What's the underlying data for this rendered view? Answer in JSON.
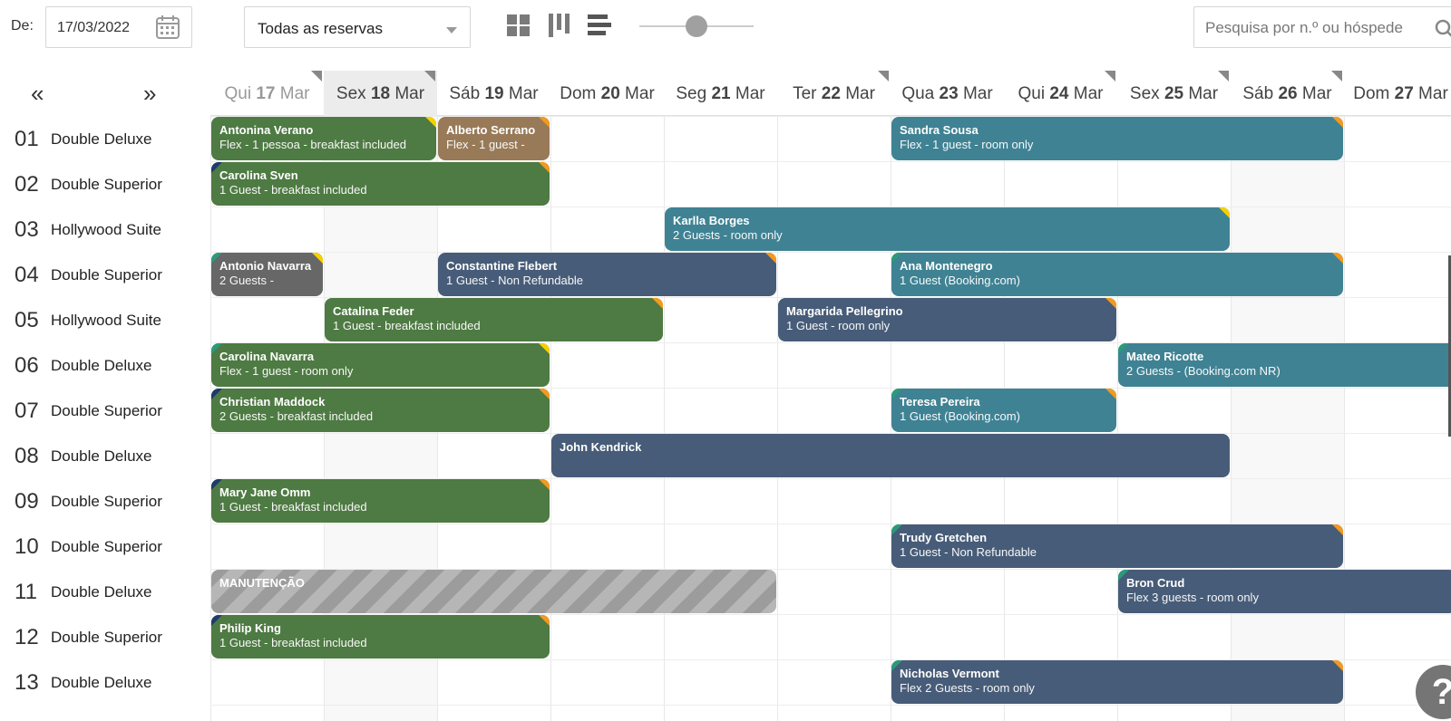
{
  "toolbar": {
    "from_label": "De:",
    "date_value": "17/03/2022",
    "filter_value": "Todas as reservas",
    "search_placeholder": "Pesquisa por n.º ou hóspede",
    "zoom_level": 0.5
  },
  "nav": {
    "prev": "«",
    "next": "»"
  },
  "days": [
    {
      "wd": "Qui",
      "d": "17",
      "m": "Mar"
    },
    {
      "wd": "Sex",
      "d": "18",
      "m": "Mar"
    },
    {
      "wd": "Sáb",
      "d": "19",
      "m": "Mar"
    },
    {
      "wd": "Dom",
      "d": "20",
      "m": "Mar"
    },
    {
      "wd": "Seg",
      "d": "21",
      "m": "Mar"
    },
    {
      "wd": "Ter",
      "d": "22",
      "m": "Mar"
    },
    {
      "wd": "Qua",
      "d": "23",
      "m": "Mar"
    },
    {
      "wd": "Qui",
      "d": "24",
      "m": "Mar"
    },
    {
      "wd": "Sex",
      "d": "25",
      "m": "Mar"
    },
    {
      "wd": "Sáb",
      "d": "26",
      "m": "Mar"
    },
    {
      "wd": "Dom",
      "d": "27",
      "m": "Mar"
    }
  ],
  "rooms": [
    {
      "num": "01",
      "name": "Double Deluxe"
    },
    {
      "num": "02",
      "name": "Double Superior"
    },
    {
      "num": "03",
      "name": "Hollywood Suite"
    },
    {
      "num": "04",
      "name": "Double Superior"
    },
    {
      "num": "05",
      "name": "Hollywood Suite"
    },
    {
      "num": "06",
      "name": "Double Deluxe"
    },
    {
      "num": "07",
      "name": "Double Superior"
    },
    {
      "num": "08",
      "name": "Double Deluxe"
    },
    {
      "num": "09",
      "name": "Double Superior"
    },
    {
      "num": "10",
      "name": "Double Superior"
    },
    {
      "num": "11",
      "name": "Double Deluxe"
    },
    {
      "num": "12",
      "name": "Double Superior"
    },
    {
      "num": "13",
      "name": "Double Deluxe"
    }
  ],
  "bookings": [
    {
      "name": "Antonina Verano",
      "info": "Flex - 1 pessoa - breakfast included",
      "room": "01",
      "from": "17/03",
      "to": "19/03",
      "color": "#4e7a43",
      "flag_right": "#f5d000"
    },
    {
      "name": "Alberto Serrano",
      "info": "Flex - 1 guest -",
      "room": "01",
      "from": "19/03",
      "to": "20/03",
      "color": "#987a58",
      "flag_right": "#f39a1e"
    },
    {
      "name": "Sandra Sousa",
      "info": "Flex - 1 guest - room only",
      "room": "01",
      "from": "23/03",
      "to": "27/03",
      "color": "#3f8293",
      "flag_right": "#f39a1e"
    },
    {
      "name": "Carolina Sven",
      "info": "1 Guest - breakfast included",
      "room": "02",
      "from": "17/03",
      "to": "20/03",
      "color": "#4e7a43",
      "flag_left": "#1e3a6e",
      "flag_right": "#f39a1e"
    },
    {
      "name": "Karlla Borges",
      "info": "2 Guests - room only",
      "room": "03",
      "from": "21/03",
      "to": "26/03",
      "color": "#3f8293",
      "flag_right": "#f5d000"
    },
    {
      "name": "Antonio Navarra",
      "info": "2 Guests -",
      "room": "04",
      "from": "17/03",
      "to": "18/03",
      "color": "#676767",
      "flag_left": "#2a9a7a",
      "flag_right": "#f5d000"
    },
    {
      "name": "Constantine Flebert",
      "info": "1 Guest - Non Refundable",
      "room": "04",
      "from": "19/03",
      "to": "22/03",
      "color": "#475c78",
      "flag_right": "#f39a1e"
    },
    {
      "name": "Ana Montenegro",
      "info": "1 Guest (Booking.com)",
      "room": "04",
      "from": "23/03",
      "to": "27/03",
      "color": "#3f8293",
      "flag_left": "#2a9a7a",
      "flag_right": "#f39a1e"
    },
    {
      "name": "Catalina Feder",
      "info": "1 Guest - breakfast included",
      "room": "05",
      "from": "18/03",
      "to": "21/03",
      "color": "#4e7a43",
      "flag_right": "#f39a1e"
    },
    {
      "name": "Margarida Pellegrino",
      "info": "1 Guest - room only",
      "room": "05",
      "from": "22/03",
      "to": "25/03",
      "color": "#475c78",
      "flag_right": "#f39a1e"
    },
    {
      "name": "Carolina Navarra",
      "info": "Flex - 1 guest - room only",
      "room": "06",
      "from": "17/03",
      "to": "20/03",
      "color": "#4e7a43",
      "flag_left": "#2a9a7a",
      "flag_right": "#f5d000"
    },
    {
      "name": "Mateo Ricotte",
      "info": "2 Guests - (Booking.com NR)",
      "room": "06",
      "from": "25/03",
      "to": "28/03",
      "color": "#3f8293",
      "flag_left": "#2a9a7a"
    },
    {
      "name": "Christian Maddock",
      "info": "2 Guests - breakfast included",
      "room": "07",
      "from": "17/03",
      "to": "20/03",
      "color": "#4e7a43",
      "flag_left": "#1e3a6e",
      "flag_right": "#f39a1e"
    },
    {
      "name": "Teresa Pereira",
      "info": "1 Guest (Booking.com)",
      "room": "07",
      "from": "23/03",
      "to": "25/03",
      "color": "#3f8293",
      "flag_left": "#2a9a7a",
      "flag_right": "#f39a1e"
    },
    {
      "name": "John Kendrick",
      "info": "",
      "room": "08",
      "from": "20/03",
      "to": "26/03",
      "color": "#475c78"
    },
    {
      "name": "Mary Jane Omm",
      "info": "1 Guest - breakfast included",
      "room": "09",
      "from": "17/03",
      "to": "20/03",
      "color": "#4e7a43",
      "flag_left": "#1e3a6e",
      "flag_right": "#f39a1e"
    },
    {
      "name": "Trudy Gretchen",
      "info": "1 Guest - Non Refundable",
      "room": "10",
      "from": "23/03",
      "to": "27/03",
      "color": "#475c78",
      "flag_left": "#2a9a7a",
      "flag_right": "#f39a1e"
    },
    {
      "name": "MANUTENÇÃO",
      "info": "",
      "room": "11",
      "from": "17/03",
      "to": "22/03",
      "color": "maintenance"
    },
    {
      "name": "Bron Crud",
      "info": "Flex 3 guests - room only",
      "room": "11",
      "from": "25/03",
      "to": "28/03",
      "color": "#475c78",
      "flag_left": "#2a9a7a"
    },
    {
      "name": "Philip King",
      "info": "1 Guest - breakfast included",
      "room": "12",
      "from": "17/03",
      "to": "20/03",
      "color": "#4e7a43",
      "flag_left": "#1e3a6e",
      "flag_right": "#f39a1e"
    },
    {
      "name": "Nicholas Vermont",
      "info": "Flex 2 Guests - room only",
      "room": "13",
      "from": "23/03",
      "to": "27/03",
      "color": "#475c78",
      "flag_left": "#2a9a7a",
      "flag_right": "#f39a1e"
    }
  ],
  "help": {
    "label": "?"
  }
}
